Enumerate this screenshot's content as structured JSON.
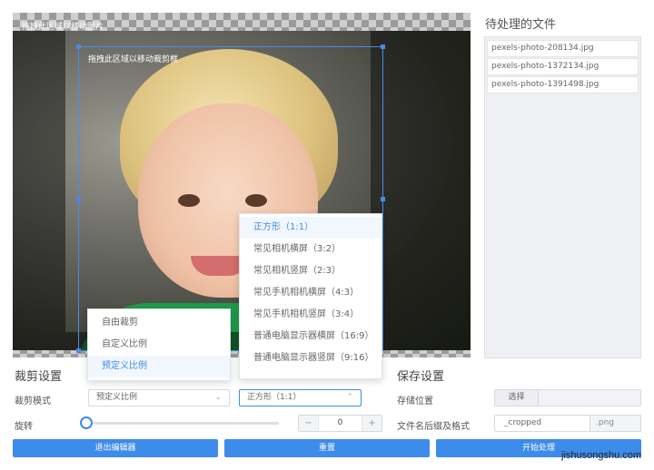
{
  "editor": {
    "canvas_hint": "拖拽此区域以移动图片",
    "crop_hint": "拖拽此区域以移动裁剪框"
  },
  "files": {
    "title": "待处理的文件",
    "items": [
      "pexels-photo-208134.jpg",
      "pexels-photo-1372134.jpg",
      "pexels-photo-1391498.jpg"
    ]
  },
  "crop_settings": {
    "title": "裁剪设置",
    "mode_label": "裁剪模式",
    "mode_value": "预定义比例",
    "ratio_value": "正方形（1:1）",
    "rotate_label": "旋转",
    "rotate_value": "0",
    "minus": "−",
    "plus": "+"
  },
  "save_settings": {
    "title": "保存设置",
    "location_label": "存储位置",
    "choose_label": "选择",
    "suffix_label": "文件名后缀及格式",
    "suffix_value": "_cropped",
    "format_value": ".png"
  },
  "mode_dropdown": {
    "options": [
      "自由裁剪",
      "自定义比例",
      "预定义比例"
    ],
    "selected": "预定义比例"
  },
  "ratio_dropdown": {
    "options": [
      "正方形（1:1）",
      "常见相机横屏（3:2）",
      "常见相机竖屏（2:3）",
      "常见手机相机横屏（4:3）",
      "常见手机相机竖屏（3:4）",
      "普通电脑显示器横屏（16:9）",
      "普通电脑显示器竖屏（9:16）"
    ],
    "selected": "正方形（1:1）"
  },
  "buttons": {
    "exit": "退出编辑器",
    "reset": "重置",
    "start": "开始处理"
  },
  "watermark": "jishusongshu.com",
  "colors": {
    "accent": "#3d8bea"
  }
}
